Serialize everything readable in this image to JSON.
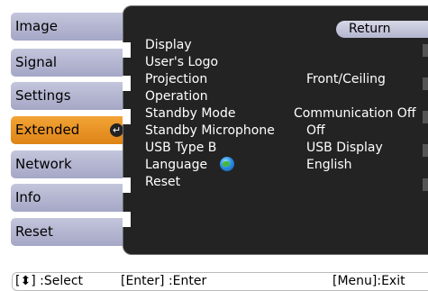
{
  "left_menu": [
    {
      "label": "Image",
      "active": false
    },
    {
      "label": "Signal",
      "active": false
    },
    {
      "label": "Settings",
      "active": false
    },
    {
      "label": "Extended",
      "active": true
    },
    {
      "label": "Network",
      "active": false
    },
    {
      "label": "Info",
      "active": false
    },
    {
      "label": "Reset",
      "active": false
    }
  ],
  "panel": {
    "return_label": "Return",
    "rows": [
      {
        "label": "Display",
        "value": ""
      },
      {
        "label": "User's Logo",
        "value": ""
      },
      {
        "label": "Projection",
        "value": "Front/Ceiling"
      },
      {
        "label": "Operation",
        "value": ""
      },
      {
        "label": "Standby Mode",
        "value": "Communication Off"
      },
      {
        "label": "Standby Microphone",
        "value": "Off"
      },
      {
        "label": "USB Type B",
        "value": "USB Display"
      },
      {
        "label": "Language",
        "value": "English"
      },
      {
        "label": "Reset",
        "value": ""
      }
    ]
  },
  "footer": {
    "select": "[⬍] :Select",
    "enter": "[Enter] :Enter",
    "menu": "[Menu]:Exit"
  },
  "icons": {
    "enter": "enter-return-icon",
    "language": "globe-icon",
    "select": "up-down-arrow-icon"
  },
  "colors": {
    "active_menu": "#e8901e",
    "menu": "#b4b7d2",
    "panel": "#232323"
  }
}
